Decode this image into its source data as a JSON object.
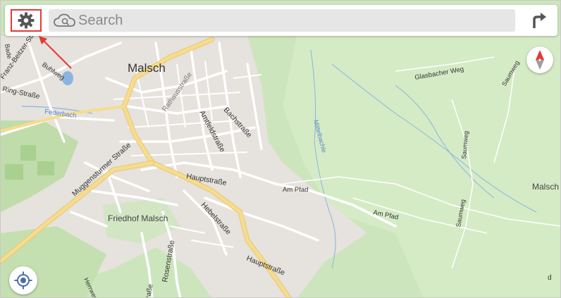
{
  "search": {
    "placeholder": "Search"
  },
  "icons": {
    "settings": "gear-icon",
    "search": "cloud-search-icon",
    "route": "turn-right-arrow-icon",
    "compass": "compass-icon",
    "locate": "locate-target-icon"
  },
  "map": {
    "town_label": "Malsch",
    "labels": {
      "friedhof": "Friedhof Malsch",
      "hauptstrasse_1": "Hauptstraße",
      "hauptstrasse_2": "Hauptstraße",
      "muggensturmer": "Muggensturmer Straße",
      "bachstrasse": "Bachstraße",
      "amtfeld": "Amtfeldstraße",
      "hebel": "Hebelstraße",
      "rosen": "Rosenstraße",
      "am_pfad_1": "Am Pfad",
      "am_pfad_2": "Am Pfad",
      "glasbacher": "Glasbacher Weg",
      "saumweg_1": "Saumweg",
      "saumweg_2": "Saumweg",
      "saumweg_3": "Saumweg",
      "mittelbach": "Mittelbachle",
      "federbach": "Federbach",
      "buhlweg": "Buhlweg",
      "malsch_right": "Malsch",
      "rathaus": "Rathausstraße",
      "herrweg": "Herrweg",
      "ringstrasse": "Ring-Straße",
      "franz_beitzer": "Franz-Beitzer-Str.",
      "partial_bottom": "raße",
      "partial_d": "d",
      "partial_left": "Bade"
    }
  },
  "colors": {
    "map_green": "#cfe6c0",
    "map_urban": "#e7e3df",
    "road": "#ffffff",
    "major_road": "#f6dc8e",
    "water": "#8ab4e0",
    "annotation": "#e53935",
    "compass_red": "#e53935"
  }
}
